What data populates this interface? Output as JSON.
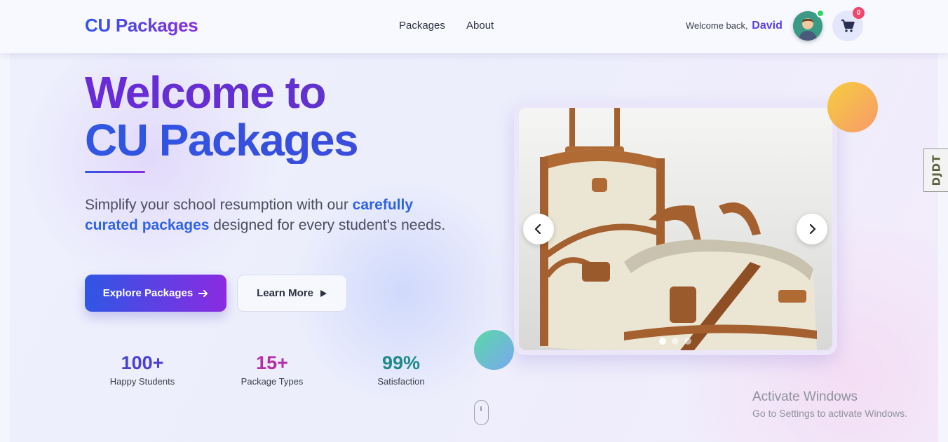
{
  "nav": {
    "brand": "CU Packages",
    "links": [
      {
        "label": "Packages"
      },
      {
        "label": "About"
      }
    ],
    "welcome_text": "Welcome back,",
    "username": "David",
    "cart_count": "0"
  },
  "hero": {
    "title_line1": "Welcome to",
    "title_line2": "CU Packages",
    "subtitle_pre": "Simplify your school resumption with our ",
    "subtitle_highlight": "carefully curated packages",
    "subtitle_post": " designed for every student's needs.",
    "primary_button": "Explore Packages",
    "secondary_button": "Learn More",
    "stats": [
      {
        "value": "100+",
        "label": "Happy Students",
        "color": "#4a3fd8"
      },
      {
        "value": "15+",
        "label": "Package Types",
        "color": "#b52fa8"
      },
      {
        "value": "99%",
        "label": "Satisfaction",
        "color": "#1f8a8a"
      }
    ]
  },
  "carousel": {
    "slide_count": 3,
    "active_slide": 1
  },
  "side_tag": "DJDT",
  "watermark": {
    "line1": "Activate Windows",
    "line2": "Go to Settings to activate Windows."
  },
  "colors": {
    "accent_blue": "#2f56e4",
    "accent_purple": "#8a2be2",
    "badge_red": "#f0466a",
    "online_green": "#33d36a"
  }
}
